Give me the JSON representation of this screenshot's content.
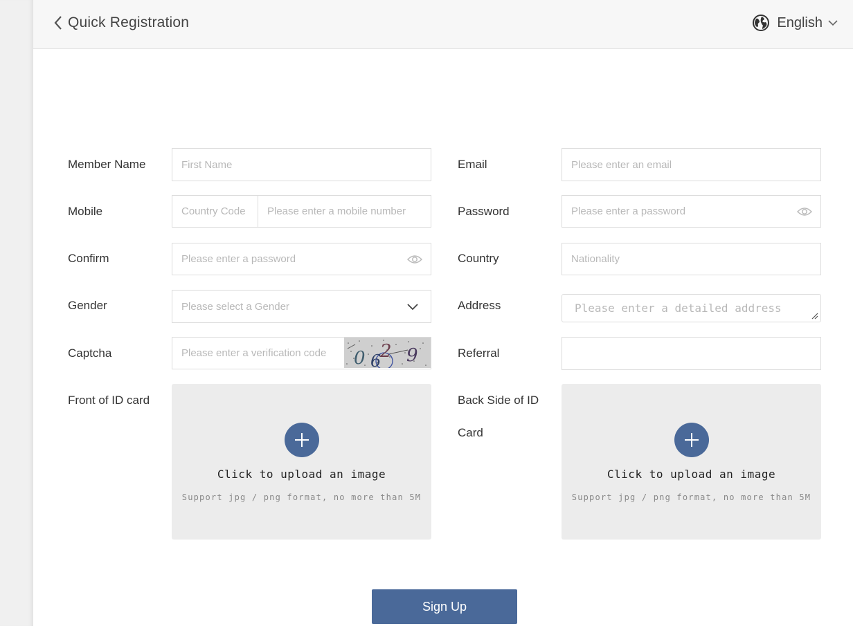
{
  "header": {
    "title": "Quick Registration",
    "language": "English"
  },
  "form": {
    "member_name": {
      "label": "Member Name",
      "placeholder": "First Name"
    },
    "email": {
      "label": "Email",
      "placeholder": "Please enter an email"
    },
    "mobile": {
      "label": "Mobile",
      "country_code_placeholder": "Country Code",
      "placeholder": "Please enter a mobile number"
    },
    "password": {
      "label": "Password",
      "placeholder": "Please enter a password"
    },
    "confirm": {
      "label": "Confirm",
      "placeholder": "Please enter a password"
    },
    "country": {
      "label": "Country",
      "placeholder": "Nationality"
    },
    "gender": {
      "label": "Gender",
      "placeholder": "Please select a Gender"
    },
    "address": {
      "label": "Address",
      "placeholder": "Please enter a detailed address"
    },
    "captcha": {
      "label": "Captcha",
      "placeholder": "Please enter a verification code",
      "code": "0629"
    },
    "referral": {
      "label": "Referral",
      "value": ""
    },
    "front_id": {
      "label": "Front of ID card",
      "upload_title": "Click to upload an image",
      "upload_hint": "Support jpg / png format, no more than 5M"
    },
    "back_id": {
      "label_line1": "Back Side of ID",
      "label_line2": "Card",
      "upload_title": "Click to upload an image",
      "upload_hint": "Support jpg / png format, no more than 5M"
    }
  },
  "signup_label": "Sign Up",
  "colors": {
    "accent": "#4a6999",
    "placeholder": "#b8b8b8",
    "header_bg": "#f7f7f7",
    "upload_bg": "#ececec"
  }
}
